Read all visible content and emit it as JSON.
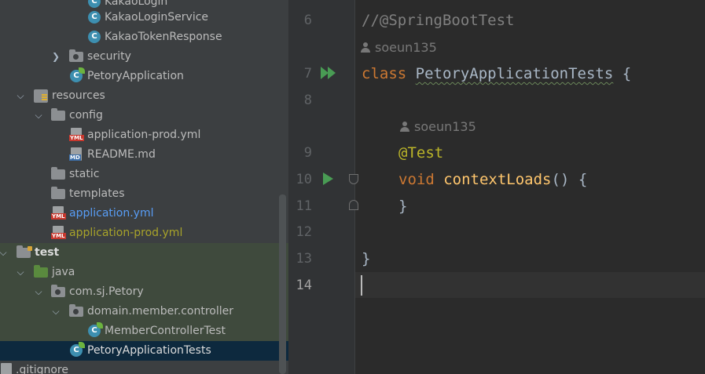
{
  "tree": {
    "items": [
      {
        "label": "KakaoLogin"
      },
      {
        "label": "KakaoLoginService"
      },
      {
        "label": "KakaoTokenResponse"
      },
      {
        "label": "security"
      },
      {
        "label": "PetoryApplication"
      },
      {
        "label": "resources"
      },
      {
        "label": "config"
      },
      {
        "label": "application-prod.yml"
      },
      {
        "label": "README.md"
      },
      {
        "label": "static"
      },
      {
        "label": "templates"
      },
      {
        "label": "application.yml"
      },
      {
        "label": "application-prod.yml"
      },
      {
        "label": "test"
      },
      {
        "label": "java"
      },
      {
        "label": "com.sj.Petory"
      },
      {
        "label": "domain.member.controller"
      },
      {
        "label": "MemberControllerTest"
      },
      {
        "label": "PetoryApplicationTests"
      },
      {
        "label": ".gitignore"
      }
    ],
    "icon_tags": {
      "yml": "YML",
      "md": "MD",
      "class": "C"
    }
  },
  "editor": {
    "line_numbers": [
      "6",
      "7",
      "8",
      "9",
      "10",
      "11",
      "12",
      "13",
      "14"
    ],
    "authors": {
      "class_author": "soeun135",
      "method_author": "soeun135"
    },
    "code": {
      "comment": "//@SpringBootTest",
      "class_kw": "class",
      "class_name": "PetoryApplicationTests",
      "class_open": " {",
      "annotation": "@Test",
      "void_kw": "void",
      "method_name": "contextLoads",
      "method_sig": "() {",
      "method_close": "}",
      "class_close": "}"
    }
  },
  "colors": {
    "keyword": "#cc7832",
    "annotation": "#bbb529",
    "method": "#ffc66d",
    "run": "#499c54"
  }
}
